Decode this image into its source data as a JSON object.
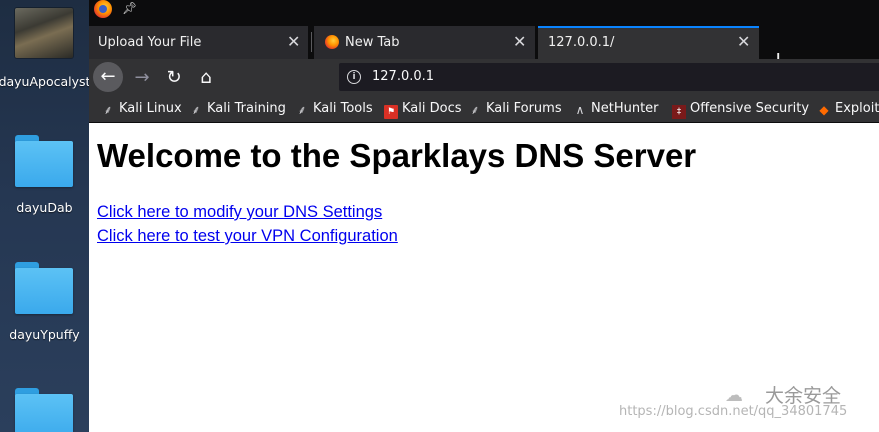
{
  "desktop": {
    "icons": [
      {
        "label": "dayuApocalyst",
        "kind": "image-thumbnail"
      },
      {
        "label": "dayuDab",
        "kind": "folder"
      },
      {
        "label": "dayuYpuffy",
        "kind": "folder"
      },
      {
        "label": "",
        "kind": "folder"
      }
    ]
  },
  "browser": {
    "tabs": [
      {
        "label": "Upload Your File",
        "active": false
      },
      {
        "label": "New Tab",
        "active": false,
        "icon": "firefox-icon"
      },
      {
        "label": "127.0.0.1/",
        "active": true
      }
    ],
    "url": "127.0.0.1",
    "bookmarks": [
      {
        "label": "Kali Linux",
        "icon": "kali-dragon-icon"
      },
      {
        "label": "Kali Training",
        "icon": "kali-dragon-icon"
      },
      {
        "label": "Kali Tools",
        "icon": "kali-dragon-icon"
      },
      {
        "label": "Kali Docs",
        "icon": "docs-icon"
      },
      {
        "label": "Kali Forums",
        "icon": "kali-dragon-icon"
      },
      {
        "label": "NetHunter",
        "icon": "nethunter-icon"
      },
      {
        "label": "Offensive Security",
        "icon": "offsec-icon"
      },
      {
        "label": "Exploit-",
        "icon": "exploit-db-icon"
      }
    ]
  },
  "page": {
    "title": "Welcome to the Sparklays DNS Server",
    "links": [
      "Click here to modify your DNS Settings",
      "Click here to test your VPN Configuration"
    ]
  },
  "watermark": {
    "brand": "大余安全",
    "url": "https://blog.csdn.net/qq_34801745"
  },
  "colors": {
    "link": "#0000ee",
    "active_tab_accent": "#0a84ff",
    "toolbar": "#323234",
    "tabstrip": "#0c0c0d"
  }
}
